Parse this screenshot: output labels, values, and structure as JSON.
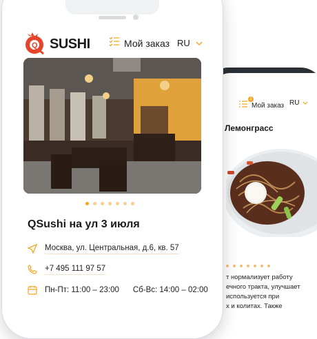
{
  "header": {
    "order_label": "Мой заказ",
    "lang": "RU",
    "logo_text": "SUSHI"
  },
  "slider": {
    "count": 7,
    "active_index": 0
  },
  "restaurant": {
    "title": "QSushi на ул 3 июля",
    "address": "Москва, ул. Центральная, д.6, кв. 57",
    "phone": "+7 495 111 97 57",
    "hours_weekdays": "Пн-Пт: 11:00 – 23:00",
    "hours_weekend": "Сб-Вс: 14:00 – 02:00"
  },
  "second_screen": {
    "order_label": "Мой заказ",
    "badge": "1",
    "lang": "RU",
    "dish_title": "ку Лемонграсс",
    "description": "т нормализует работу\nечного тракта, улучшает\nиспользуется при\nх и колитах. Также"
  },
  "colors": {
    "accent": "#f5a623",
    "back_phone": "#2b3036"
  }
}
